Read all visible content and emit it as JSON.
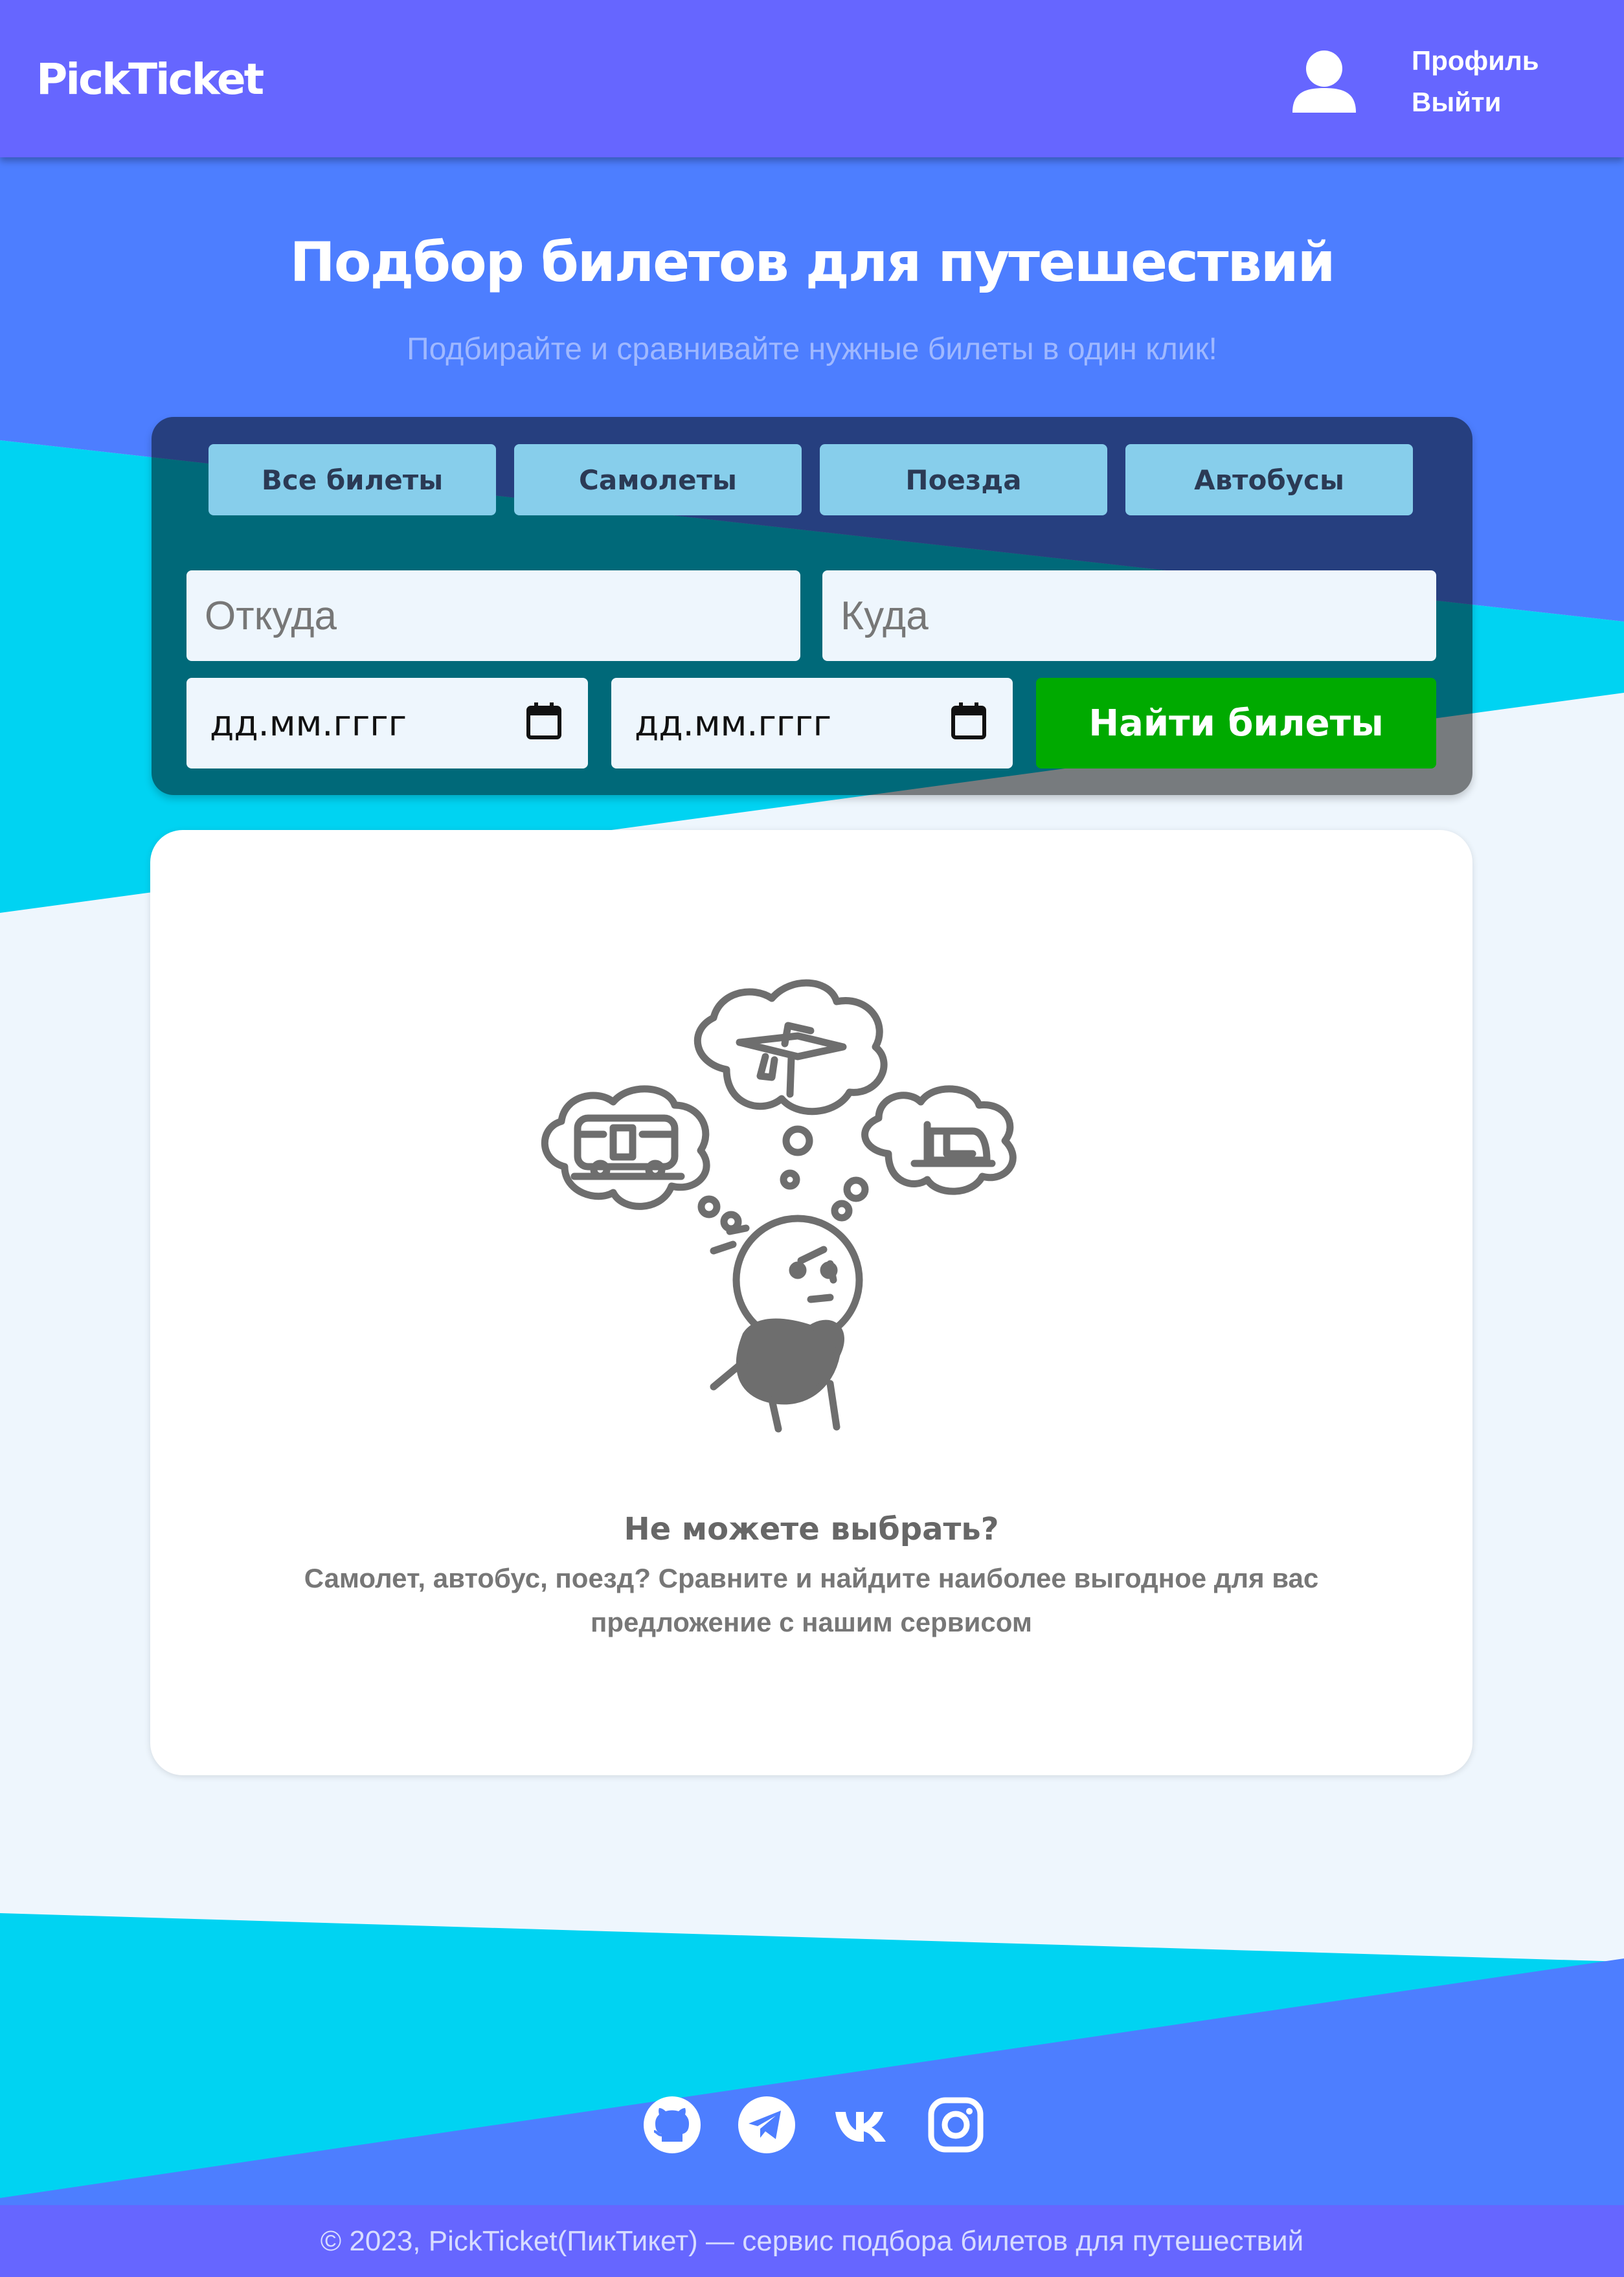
{
  "header": {
    "logo": "PickTicket",
    "profile_label": "Профиль",
    "logout_label": "Выйти"
  },
  "hero": {
    "title": "Подбор билетов для путешествий",
    "subtitle": "Подбирайте и сравнивайте нужные билеты в один клик!"
  },
  "search": {
    "tabs": [
      {
        "label": "Все билеты"
      },
      {
        "label": "Самолеты"
      },
      {
        "label": "Поезда"
      },
      {
        "label": "Автобусы"
      }
    ],
    "from_placeholder": "Откуда",
    "to_placeholder": "Куда",
    "date_from_placeholder": "дд.мм.гггг",
    "date_to_placeholder": "дд.мм.гггг",
    "submit_label": "Найти билеты"
  },
  "card": {
    "title": "Не можете выбрать?",
    "text": "Самолет, автобус, поезд? Сравните и найдите наиболее выгодное для вас предложение с нашим сервисом"
  },
  "social": [
    {
      "icon": "github-icon"
    },
    {
      "icon": "telegram-icon"
    },
    {
      "icon": "vk-icon"
    },
    {
      "icon": "instagram-icon"
    }
  ],
  "footer": {
    "copyright": "© 2023, PickTicket(ПикТикет) — сервис подбора билетов для путешествий"
  },
  "colors": {
    "header": "#6666ff",
    "primary_blue": "#4d7eff",
    "cyan": "#00d3f2",
    "tab": "#87ceeb",
    "submit": "#00aa00",
    "page": "#eef6fd"
  }
}
